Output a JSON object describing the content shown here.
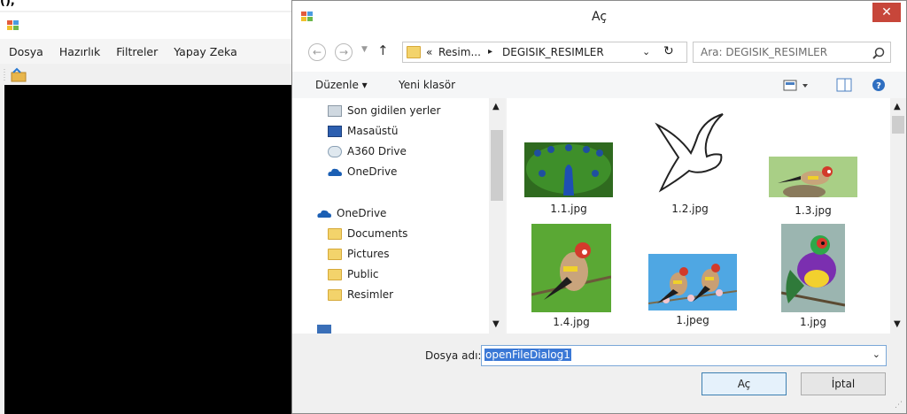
{
  "app": {
    "code_fragment": "(),",
    "menu": [
      "Dosya",
      "Hazırlık",
      "Filtreler",
      "Yapay Zeka"
    ]
  },
  "dialog": {
    "title": "Aç",
    "close": "✕",
    "breadcrumb": [
      "«",
      "Resim...",
      "▸",
      "DEGISIK_RESIMLER"
    ],
    "search_placeholder": "Ara: DEGISIK_RESIMLER",
    "toolbar": {
      "organize": "Düzenle ▾",
      "new_folder": "Yeni klasör"
    },
    "nav_items": [
      {
        "label": "Son gidilen yerler",
        "icon": "recent-places-icon"
      },
      {
        "label": "Masaüstü",
        "icon": "desktop-icon"
      },
      {
        "label": "A360 Drive",
        "icon": "a360-drive-icon"
      },
      {
        "label": "OneDrive",
        "icon": "onedrive-cloud-icon"
      },
      {
        "label": "OneDrive",
        "icon": "onedrive-cloud-icon"
      },
      {
        "label": "Documents",
        "icon": "folder-icon"
      },
      {
        "label": "Pictures",
        "icon": "folder-icon"
      },
      {
        "label": "Public",
        "icon": "folder-icon"
      },
      {
        "label": "Resimler",
        "icon": "folder-icon"
      }
    ],
    "files": [
      {
        "name": "1.1.jpg"
      },
      {
        "name": "1.2.jpg"
      },
      {
        "name": "1.3.jpg"
      },
      {
        "name": "1.4.jpg"
      },
      {
        "name": "1.jpeg"
      },
      {
        "name": "1.jpg"
      }
    ],
    "filename_label": "Dosya adı:",
    "filename_value": "openFileDialog1",
    "open_button": "Aç",
    "cancel_button": "İptal"
  }
}
